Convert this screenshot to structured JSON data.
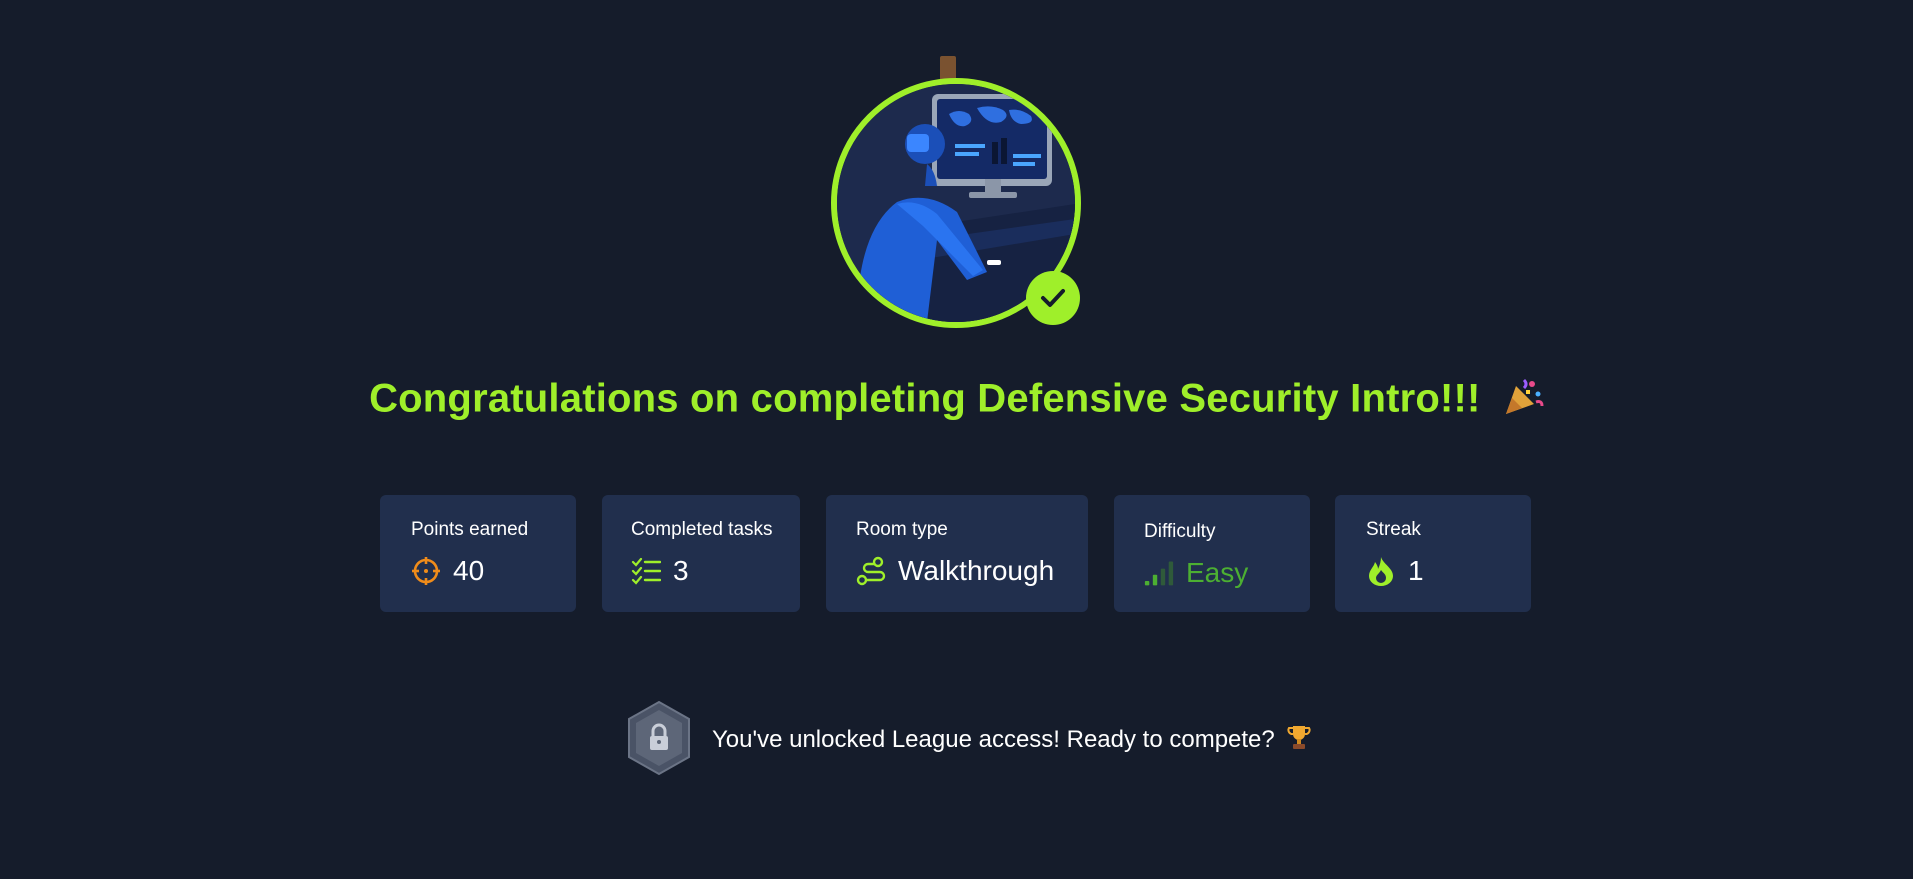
{
  "hero": {
    "illustration": "hacker-at-computer-illustration",
    "status_icon": "check-icon",
    "accent_color": "#9fef2a"
  },
  "title": {
    "text": "Congratulations on completing Defensive Security Intro!!!",
    "emoji": "party-popper-icon"
  },
  "stats": [
    {
      "label": "Points earned",
      "value": "40",
      "icon": "target-icon",
      "icon_color": "#f08c1a"
    },
    {
      "label": "Completed tasks",
      "value": "3",
      "icon": "checklist-icon",
      "icon_color": "#9fef2a"
    },
    {
      "label": "Room type",
      "value": "Walkthrough",
      "icon": "route-icon",
      "icon_color": "#9fef2a"
    },
    {
      "label": "Difficulty",
      "value": "Easy",
      "icon": "signal-bars-icon",
      "icon_color": "#4caf32"
    },
    {
      "label": "Streak",
      "value": "1",
      "icon": "flame-icon",
      "icon_color": "#9fef2a"
    }
  ],
  "league": {
    "text": "You've unlocked League access! Ready to compete?",
    "badge_icon": "locked-hexagon-badge-icon",
    "emoji": "trophy-icon"
  },
  "colors": {
    "background": "#151c2b",
    "card": "#212f4d",
    "accent": "#9fef2a"
  }
}
